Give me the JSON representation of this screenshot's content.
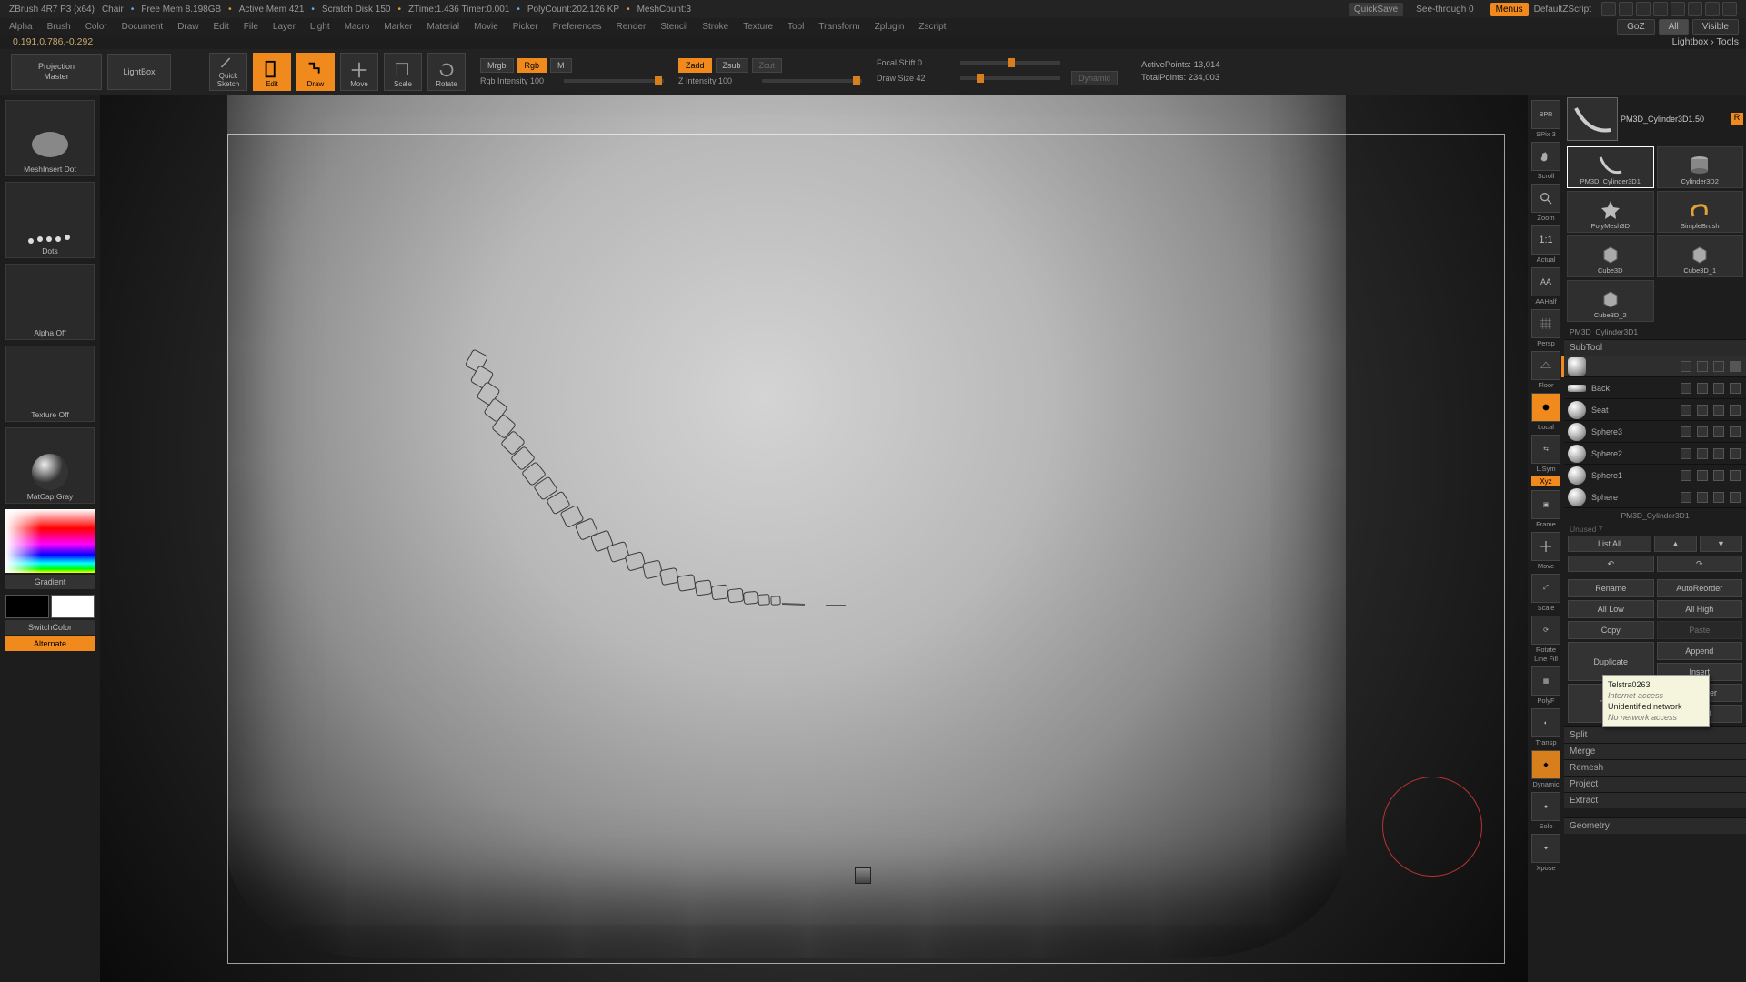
{
  "app": {
    "title": "ZBrush 4R7 P3 (x64)",
    "project": "Chair",
    "freemem": "Free Mem 8.198GB",
    "activemem": "Active Mem 421",
    "scratch": "Scratch Disk 150",
    "ztime": "ZTime:1.436 Timer:0.001",
    "polycount": "PolyCount:202.126 KP",
    "meshcount": "MeshCount:3",
    "quicksave": "QuickSave",
    "seethrough": "See-through  0",
    "menus": "Menus",
    "script": "DefaultZScript"
  },
  "menubar": [
    "Alpha",
    "Brush",
    "Color",
    "Document",
    "Draw",
    "Edit",
    "File",
    "Layer",
    "Light",
    "Macro",
    "Marker",
    "Material",
    "Movie",
    "Picker",
    "Preferences",
    "Render",
    "Stencil",
    "Stroke",
    "Texture",
    "Tool",
    "Transform",
    "Zplugin",
    "Zscript"
  ],
  "right_chips": {
    "goz": "GoZ",
    "all": "All",
    "visible": "Visible"
  },
  "coord": "0.191,0.786,-0.292",
  "breadcrumb": "Lightbox › Tools",
  "opt": {
    "projection": "Projection\nMaster",
    "lightbox": "LightBox",
    "quicksketch": "Quick\nSketch",
    "edit": "Edit",
    "draw": "Draw",
    "move": "Move",
    "scale": "Scale",
    "rotate": "Rotate",
    "mrgb": "Mrgb",
    "rgb": "Rgb",
    "m": "M",
    "zadd": "Zadd",
    "zsub": "Zsub",
    "zcut": "Zcut",
    "rgb_int": "Rgb Intensity 100",
    "z_int": "Z Intensity 100",
    "focal": "Focal Shift 0",
    "drawsize": "Draw Size 42",
    "dynamic": "Dynamic",
    "active": "ActivePoints: 13,014",
    "total": "TotalPoints: 234,003"
  },
  "left": {
    "brush": "MeshInsert Dot",
    "stroke": "Dots",
    "alpha": "Alpha Off",
    "texture": "Texture Off",
    "material": "MatCap Gray",
    "gradient": "Gradient",
    "switch": "SwitchColor",
    "alternate": "Alternate"
  },
  "shelf": [
    "BPR",
    "Scroll",
    "Zoom",
    "Actual",
    "AAHalf",
    "Persp",
    "Floor",
    "Local",
    "L.Sym",
    "Frame",
    "Move",
    "Scale",
    "Rotate",
    "PolyF",
    "Transp",
    "Solo",
    "Xpose"
  ],
  "shelf_pills": {
    "spix": "SPix 3",
    "xyz": "Xyz",
    "linefill": "Line Fill",
    "dynamic": "Dynamic"
  },
  "tool": {
    "name": "PM3D_Cylinder3D1.50",
    "grid": [
      {
        "n": "PM3D_Cylinder3D1",
        "sel": true
      },
      {
        "n": "Cylinder3D2"
      },
      {
        "n": "PolyMesh3D"
      },
      {
        "n": "SimpleBrush"
      },
      {
        "n": "Cube3D"
      },
      {
        "n": "Cube3D_1"
      },
      {
        "n": "Cube3D_2"
      }
    ],
    "current": "PM3D_Cylinder3D1"
  },
  "subtool": {
    "header": "SubTool",
    "items": [
      {
        "name": " ",
        "sel": true
      },
      {
        "name": "Back"
      },
      {
        "name": "Seat"
      },
      {
        "name": "Sphere3"
      },
      {
        "name": "Sphere2"
      },
      {
        "name": "Sphere1"
      },
      {
        "name": "Sphere"
      }
    ],
    "footer": "PM3D_Cylinder3D1",
    "unused": "Unused 7",
    "listall": "List All",
    "ops": {
      "rename": "Rename",
      "autoreorder": "AutoReorder",
      "alllow": "All Low",
      "allhigh": "All High",
      "copy": "Copy",
      "paste": "Paste",
      "duplicate": "Duplicate",
      "append": "Append",
      "insert": "Insert",
      "delete": "Delete",
      "delother": "Del Other",
      "delall": "Del All",
      "split": "Split",
      "merge": "Merge",
      "remesh": "Remesh",
      "project": "Project",
      "extract": "Extract",
      "geometry": "Geometry"
    }
  },
  "net": {
    "ssid": "Telstra0263",
    "l1": "Internet access",
    "l2": "Unidentified network",
    "l3": "No network access"
  }
}
